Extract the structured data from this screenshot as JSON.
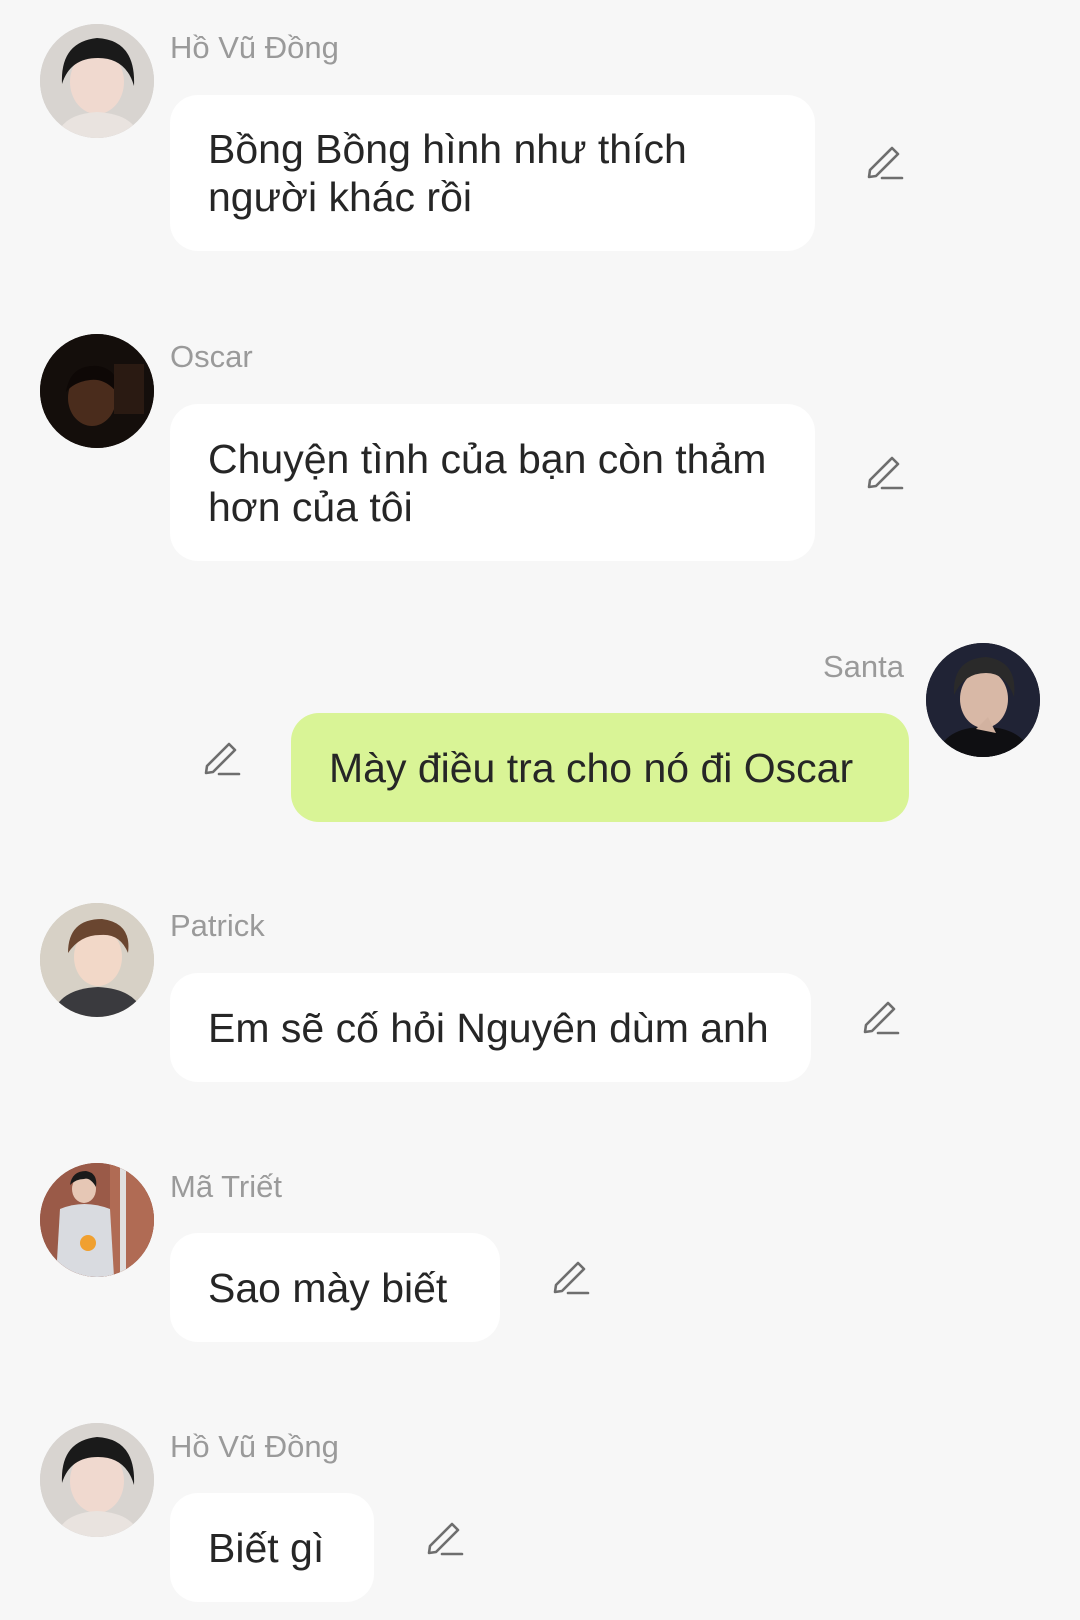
{
  "colors": {
    "background": "#f7f7f7",
    "bubble_incoming": "#ffffff",
    "bubble_outgoing": "#d9f496",
    "sender_name": "#9a9a9a",
    "message_text": "#262626",
    "edit_icon": "#6e6e6e"
  },
  "messages": [
    {
      "sender": "Hồ Vũ Đồng",
      "text": "Bồng Bồng hình như thích người khác rồi",
      "outgoing": false,
      "avatar_icon": "user-avatar-icon",
      "edit_icon": "pencil-icon"
    },
    {
      "sender": "Oscar",
      "text": "Chuyện tình của bạn còn thảm hơn của tôi",
      "outgoing": false,
      "avatar_icon": "user-avatar-icon",
      "edit_icon": "pencil-icon"
    },
    {
      "sender": "Santa",
      "text": "Mày điều tra cho nó đi Oscar",
      "outgoing": true,
      "avatar_icon": "user-avatar-icon",
      "edit_icon": "pencil-icon"
    },
    {
      "sender": "Patrick",
      "text": "Em sẽ cố hỏi Nguyên dùm anh",
      "outgoing": false,
      "avatar_icon": "user-avatar-icon",
      "edit_icon": "pencil-icon"
    },
    {
      "sender": "Mã Triết",
      "text": "Sao mày biết",
      "outgoing": false,
      "avatar_icon": "user-avatar-icon",
      "edit_icon": "pencil-icon"
    },
    {
      "sender": "Hồ Vũ Đồng",
      "text": "Biết gì",
      "outgoing": false,
      "avatar_icon": "user-avatar-icon",
      "edit_icon": "pencil-icon"
    }
  ]
}
